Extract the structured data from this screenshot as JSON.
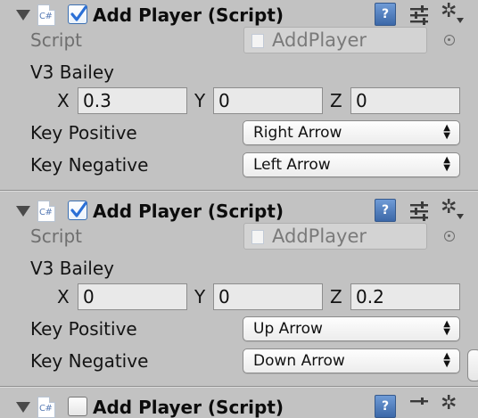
{
  "colors": {
    "panel_bg": "#c2c2c2",
    "check_blue": "#2a6fd6",
    "help_icon_blue": "#4a78b8"
  },
  "components": [
    {
      "title": "Add Player (Script)",
      "enabled": true,
      "script_label": "Script",
      "script_value": "AddPlayer",
      "vector_label": "V3 Bailey",
      "x_label": "X",
      "x_value": "0.3",
      "y_label": "Y",
      "y_value": "0",
      "z_label": "Z",
      "z_value": "0",
      "key_positive_label": "Key Positive",
      "key_positive_value": "Right Arrow",
      "key_negative_label": "Key Negative",
      "key_negative_value": "Left Arrow"
    },
    {
      "title": "Add Player (Script)",
      "enabled": true,
      "script_label": "Script",
      "script_value": "AddPlayer",
      "vector_label": "V3 Bailey",
      "x_label": "X",
      "x_value": "0",
      "y_label": "Y",
      "y_value": "0",
      "z_label": "Z",
      "z_value": "0.2",
      "key_positive_label": "Key Positive",
      "key_positive_value": "Up Arrow",
      "key_negative_label": "Key Negative",
      "key_negative_value": "Down Arrow"
    },
    {
      "title": "Add Player (Script)",
      "enabled": false
    }
  ],
  "icons": {
    "cs_script_glyph": "C#",
    "help_glyph": "?",
    "gear_glyph": "✲",
    "popup_arrows": "▲▼"
  }
}
